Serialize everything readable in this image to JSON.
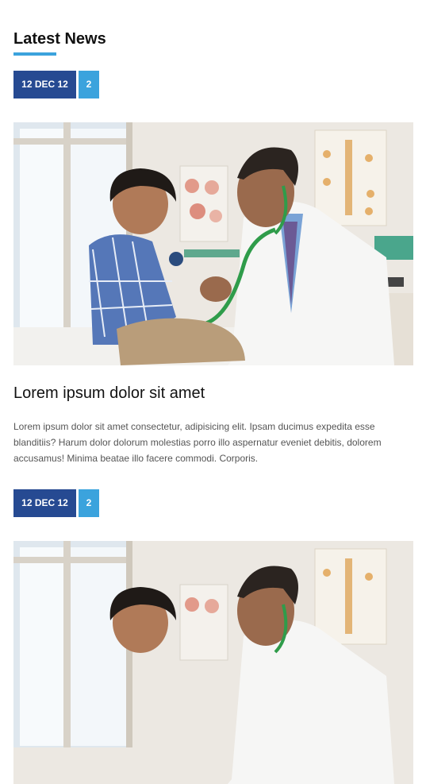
{
  "section": {
    "title": "Latest News"
  },
  "posts": [
    {
      "date": "12 DEC 12",
      "count": "2",
      "title": "Lorem ipsum dolor sit amet",
      "excerpt": "Lorem ipsum dolor sit amet consectetur, adipisicing elit. Ipsam ducimus expedita esse blanditiis? Harum dolor dolorum molestias porro illo aspernatur eveniet debitis, dolorem accusamus! Minima beatae illo facere commodi. Corporis."
    },
    {
      "date": "12 DEC 12",
      "count": "2"
    }
  ],
  "colors": {
    "date_badge": "#264a92",
    "count_badge": "#3ba3dd",
    "accent_underline": "#3ba3dd"
  }
}
